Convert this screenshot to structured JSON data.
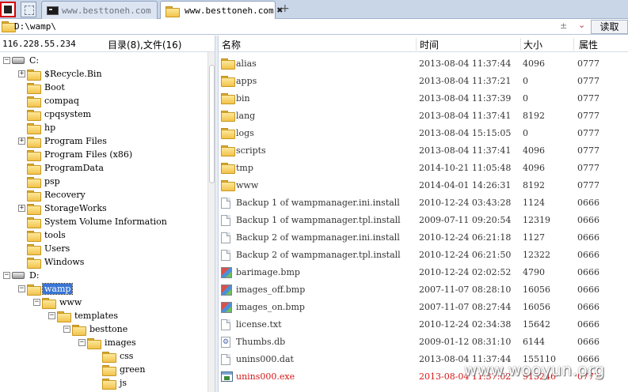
{
  "tabs": [
    {
      "label": "www.besttoneh.com",
      "icon": "terminal-icon",
      "active": false
    },
    {
      "label": "www.besttoneh.com",
      "icon": "folder-icon",
      "active": true
    }
  ],
  "tab_add_label": "+",
  "tab_close_label": "✖",
  "path": {
    "value": "D:\\wamp\\",
    "control_glyph": "±",
    "dropdown_glyph": "⌄",
    "read_label": "读取"
  },
  "left_info": {
    "ip": "116.228.55.234",
    "counts": "目录(8),文件(16)"
  },
  "tree": [
    {
      "label": "C:",
      "level": 0,
      "type": "drive",
      "expander": "−"
    },
    {
      "label": "$Recycle.Bin",
      "level": 1,
      "type": "folder",
      "expander": "+"
    },
    {
      "label": "Boot",
      "level": 1,
      "type": "folder",
      "expander": ""
    },
    {
      "label": "compaq",
      "level": 1,
      "type": "folder",
      "expander": ""
    },
    {
      "label": "cpqsystem",
      "level": 1,
      "type": "folder",
      "expander": ""
    },
    {
      "label": "hp",
      "level": 1,
      "type": "folder",
      "expander": ""
    },
    {
      "label": "Program Files",
      "level": 1,
      "type": "folder",
      "expander": "+"
    },
    {
      "label": "Program Files (x86)",
      "level": 1,
      "type": "folder",
      "expander": ""
    },
    {
      "label": "ProgramData",
      "level": 1,
      "type": "folder",
      "expander": ""
    },
    {
      "label": "psp",
      "level": 1,
      "type": "folder",
      "expander": ""
    },
    {
      "label": "Recovery",
      "level": 1,
      "type": "folder",
      "expander": ""
    },
    {
      "label": "StorageWorks",
      "level": 1,
      "type": "folder",
      "expander": "+"
    },
    {
      "label": "System Volume Information",
      "level": 1,
      "type": "folder",
      "expander": ""
    },
    {
      "label": "tools",
      "level": 1,
      "type": "folder",
      "expander": ""
    },
    {
      "label": "Users",
      "level": 1,
      "type": "folder",
      "expander": ""
    },
    {
      "label": "Windows",
      "level": 1,
      "type": "folder",
      "expander": ""
    },
    {
      "label": "D:",
      "level": 0,
      "type": "drive",
      "expander": "−"
    },
    {
      "label": "wamp",
      "level": 1,
      "type": "folder",
      "expander": "−",
      "selected": true
    },
    {
      "label": "www",
      "level": 2,
      "type": "folder",
      "expander": "−"
    },
    {
      "label": "templates",
      "level": 3,
      "type": "folder",
      "expander": "−"
    },
    {
      "label": "besttone",
      "level": 4,
      "type": "folder",
      "expander": "−"
    },
    {
      "label": "images",
      "level": 5,
      "type": "folder",
      "expander": "−"
    },
    {
      "label": "css",
      "level": 6,
      "type": "folder",
      "expander": ""
    },
    {
      "label": "green",
      "level": 6,
      "type": "folder",
      "expander": ""
    },
    {
      "label": "js",
      "level": 6,
      "type": "folder",
      "expander": ""
    }
  ],
  "columns": {
    "name": "名称",
    "time": "时间",
    "size": "大小",
    "attr": "属性"
  },
  "files": [
    {
      "name": "alias",
      "time": "2013-08-04 11:37:44",
      "size": "4096",
      "attr": "0777",
      "icon": "folder"
    },
    {
      "name": "apps",
      "time": "2013-08-04 11:37:21",
      "size": "0",
      "attr": "0777",
      "icon": "folder"
    },
    {
      "name": "bin",
      "time": "2013-08-04 11:37:39",
      "size": "0",
      "attr": "0777",
      "icon": "folder"
    },
    {
      "name": "lang",
      "time": "2013-08-04 11:37:41",
      "size": "8192",
      "attr": "0777",
      "icon": "folder"
    },
    {
      "name": "logs",
      "time": "2013-08-04 15:15:05",
      "size": "0",
      "attr": "0777",
      "icon": "folder"
    },
    {
      "name": "scripts",
      "time": "2013-08-04 11:37:41",
      "size": "4096",
      "attr": "0777",
      "icon": "folder"
    },
    {
      "name": "tmp",
      "time": "2014-10-21 11:05:48",
      "size": "4096",
      "attr": "0777",
      "icon": "folder"
    },
    {
      "name": "www",
      "time": "2014-04-01 14:26:31",
      "size": "8192",
      "attr": "0777",
      "icon": "folder"
    },
    {
      "name": "Backup 1 of wampmanager.ini.install",
      "time": "2010-12-24 03:43:28",
      "size": "1124",
      "attr": "0666",
      "icon": "doc"
    },
    {
      "name": "Backup 1 of wampmanager.tpl.install",
      "time": "2009-07-11 09:20:54",
      "size": "12319",
      "attr": "0666",
      "icon": "doc"
    },
    {
      "name": "Backup 2 of wampmanager.ini.install",
      "time": "2010-12-24 06:21:18",
      "size": "1127",
      "attr": "0666",
      "icon": "doc"
    },
    {
      "name": "Backup 2 of wampmanager.tpl.install",
      "time": "2010-12-24 06:21:50",
      "size": "12322",
      "attr": "0666",
      "icon": "doc"
    },
    {
      "name": "barimage.bmp",
      "time": "2010-12-24 02:02:52",
      "size": "4790",
      "attr": "0666",
      "icon": "image"
    },
    {
      "name": "images_off.bmp",
      "time": "2007-11-07 08:28:10",
      "size": "16056",
      "attr": "0666",
      "icon": "image"
    },
    {
      "name": "images_on.bmp",
      "time": "2007-11-07 08:27:44",
      "size": "16056",
      "attr": "0666",
      "icon": "image"
    },
    {
      "name": "license.txt",
      "time": "2010-12-24 02:34:38",
      "size": "15642",
      "attr": "0666",
      "icon": "doc"
    },
    {
      "name": "Thumbs.db",
      "time": "2009-01-12 08:31:10",
      "size": "6144",
      "attr": "0666",
      "icon": "gear-doc"
    },
    {
      "name": "unins000.dat",
      "time": "2013-08-04 11:37:44",
      "size": "155110",
      "attr": "0666",
      "icon": "doc"
    },
    {
      "name": "unins000.exe",
      "time": "2013-08-04 11:37:02",
      "size": "913246",
      "attr": "0777",
      "icon": "exe",
      "highlight": true
    }
  ],
  "watermark": "www.wooyun.org",
  "colors": {
    "selection": "#3875d7",
    "executable_text": "#d41616",
    "tabbar": "#c9d6e8"
  }
}
